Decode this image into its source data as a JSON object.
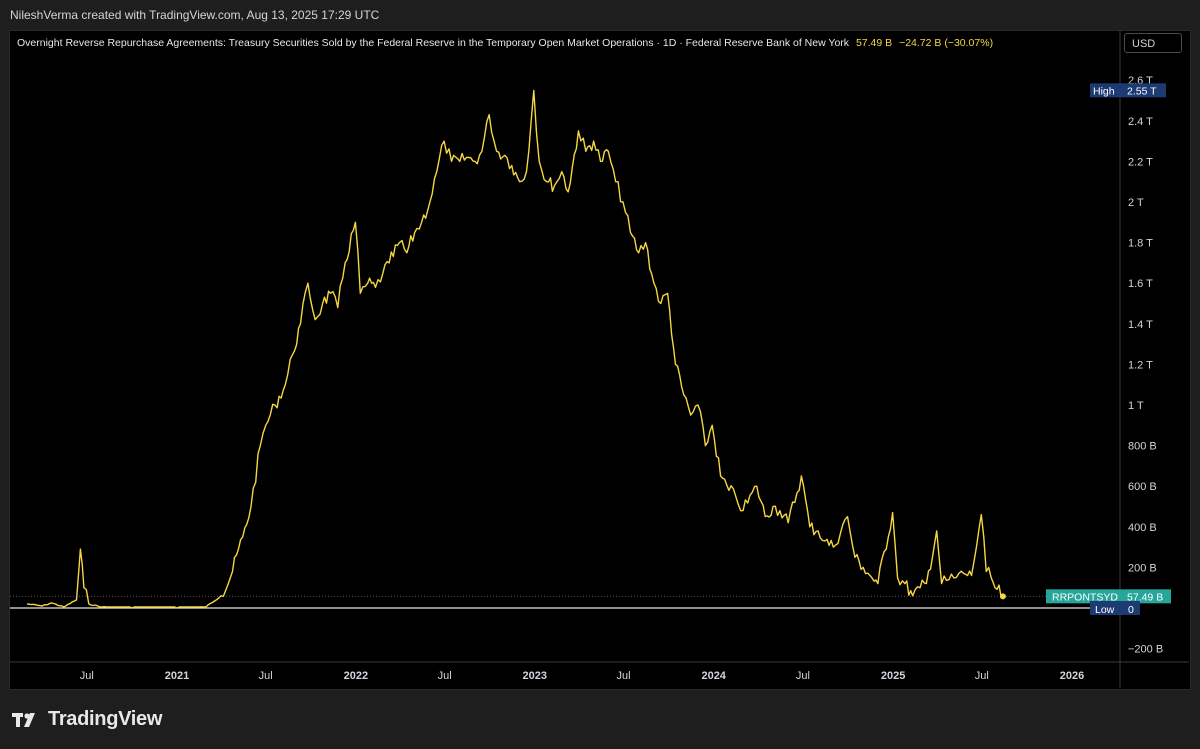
{
  "header": {
    "credit": "NileshVerma created with TradingView.com, Aug 13, 2025 17:29 UTC"
  },
  "legend": {
    "title": "Overnight Reverse Repurchase Agreements: Treasury Securities Sold by the Federal Reserve in the Temporary Open Market Operations · 1D · Federal Reserve Bank of New York",
    "last": "57.49 B",
    "change": "−24.72 B (−30.07%)"
  },
  "currency": "USD",
  "footer": {
    "brand": "TradingView"
  },
  "colors": {
    "series": "#f5d742",
    "background": "#000000",
    "low_line": "#e8e8e8",
    "symbol_label": "#26a69a",
    "high_low_label": "#1e3a72"
  },
  "chart_data": {
    "type": "line",
    "symbol": "RRPONTSYD",
    "y_unit": "USD",
    "ylim": [
      -200000000000,
      2600000000000
    ],
    "y_ticks": [
      {
        "v": 2600000000000,
        "label": "2.6 T"
      },
      {
        "v": 2400000000000,
        "label": "2.4 T"
      },
      {
        "v": 2200000000000,
        "label": "2.2 T"
      },
      {
        "v": 2000000000000,
        "label": "2 T"
      },
      {
        "v": 1800000000000,
        "label": "1.8 T"
      },
      {
        "v": 1600000000000,
        "label": "1.6 T"
      },
      {
        "v": 1400000000000,
        "label": "1.4 T"
      },
      {
        "v": 1200000000000,
        "label": "1.2 T"
      },
      {
        "v": 1000000000000,
        "label": "1 T"
      },
      {
        "v": 800000000000,
        "label": "800 B"
      },
      {
        "v": 600000000000,
        "label": "600 B"
      },
      {
        "v": 400000000000,
        "label": "400 B"
      },
      {
        "v": 200000000000,
        "label": "200 B"
      },
      {
        "v": -200000000000,
        "label": "−200 B"
      }
    ],
    "x_ticks": [
      {
        "date": "2020-07-01",
        "label": "Jul",
        "bold": false
      },
      {
        "date": "2021-01-01",
        "label": "2021",
        "bold": true
      },
      {
        "date": "2021-07-01",
        "label": "Jul",
        "bold": false
      },
      {
        "date": "2022-01-01",
        "label": "2022",
        "bold": true
      },
      {
        "date": "2022-07-01",
        "label": "Jul",
        "bold": false
      },
      {
        "date": "2023-01-01",
        "label": "2023",
        "bold": true
      },
      {
        "date": "2023-07-01",
        "label": "Jul",
        "bold": false
      },
      {
        "date": "2024-01-01",
        "label": "2024",
        "bold": true
      },
      {
        "date": "2024-07-01",
        "label": "Jul",
        "bold": false
      },
      {
        "date": "2025-01-01",
        "label": "2025",
        "bold": true
      },
      {
        "date": "2025-07-01",
        "label": "Jul",
        "bold": false
      },
      {
        "date": "2026-01-01",
        "label": "2026",
        "bold": true
      }
    ],
    "markers": {
      "high": {
        "label": "High",
        "value_label": "2.55 T",
        "value": 2550000000000
      },
      "last": {
        "label": "RRPONTSYD",
        "value_label": "57.49 B",
        "value": 57490000000
      },
      "low": {
        "label": "Low",
        "value_label": "0",
        "value": 0
      }
    },
    "series": [
      {
        "points": [
          [
            "2020-03-01",
            20000000000
          ],
          [
            "2020-04-01",
            10000000000
          ],
          [
            "2020-04-20",
            25000000000
          ],
          [
            "2020-05-15",
            5000000000
          ],
          [
            "2020-06-10",
            40000000000
          ],
          [
            "2020-06-18",
            290000000000
          ],
          [
            "2020-06-25",
            100000000000
          ],
          [
            "2020-07-05",
            20000000000
          ],
          [
            "2020-08-01",
            5000000000
          ],
          [
            "2020-10-01",
            1000000000
          ],
          [
            "2021-01-01",
            0
          ],
          [
            "2021-03-01",
            5000000000
          ],
          [
            "2021-04-01",
            60000000000
          ],
          [
            "2021-04-20",
            150000000000
          ],
          [
            "2021-05-15",
            350000000000
          ],
          [
            "2021-06-01",
            500000000000
          ],
          [
            "2021-06-20",
            800000000000
          ],
          [
            "2021-07-01",
            900000000000
          ],
          [
            "2021-07-20",
            1000000000000
          ],
          [
            "2021-08-10",
            1100000000000
          ],
          [
            "2021-08-25",
            1250000000000
          ],
          [
            "2021-09-10",
            1400000000000
          ],
          [
            "2021-09-25",
            1600000000000
          ],
          [
            "2021-10-10",
            1420000000000
          ],
          [
            "2021-10-25",
            1500000000000
          ],
          [
            "2021-11-10",
            1550000000000
          ],
          [
            "2021-11-25",
            1480000000000
          ],
          [
            "2021-12-10",
            1700000000000
          ],
          [
            "2021-12-31",
            1900000000000
          ],
          [
            "2022-01-10",
            1550000000000
          ],
          [
            "2022-01-25",
            1600000000000
          ],
          [
            "2022-02-10",
            1580000000000
          ],
          [
            "2022-02-25",
            1650000000000
          ],
          [
            "2022-03-10",
            1700000000000
          ],
          [
            "2022-03-31",
            1800000000000
          ],
          [
            "2022-04-15",
            1750000000000
          ],
          [
            "2022-05-01",
            1850000000000
          ],
          [
            "2022-05-15",
            1900000000000
          ],
          [
            "2022-06-01",
            2000000000000
          ],
          [
            "2022-06-15",
            2150000000000
          ],
          [
            "2022-06-30",
            2300000000000
          ],
          [
            "2022-07-15",
            2200000000000
          ],
          [
            "2022-08-01",
            2200000000000
          ],
          [
            "2022-08-15",
            2220000000000
          ],
          [
            "2022-09-01",
            2200000000000
          ],
          [
            "2022-09-15",
            2250000000000
          ],
          [
            "2022-09-30",
            2430000000000
          ],
          [
            "2022-10-15",
            2250000000000
          ],
          [
            "2022-11-01",
            2230000000000
          ],
          [
            "2022-11-15",
            2180000000000
          ],
          [
            "2022-12-01",
            2100000000000
          ],
          [
            "2022-12-15",
            2150000000000
          ],
          [
            "2022-12-30",
            2550000000000
          ],
          [
            "2023-01-10",
            2200000000000
          ],
          [
            "2023-01-25",
            2100000000000
          ],
          [
            "2023-02-10",
            2080000000000
          ],
          [
            "2023-02-25",
            2150000000000
          ],
          [
            "2023-03-10",
            2050000000000
          ],
          [
            "2023-03-31",
            2350000000000
          ],
          [
            "2023-04-15",
            2250000000000
          ],
          [
            "2023-05-01",
            2300000000000
          ],
          [
            "2023-05-15",
            2200000000000
          ],
          [
            "2023-05-31",
            2250000000000
          ],
          [
            "2023-06-15",
            2100000000000
          ],
          [
            "2023-06-30",
            2000000000000
          ],
          [
            "2023-07-15",
            1850000000000
          ],
          [
            "2023-08-01",
            1750000000000
          ],
          [
            "2023-08-15",
            1800000000000
          ],
          [
            "2023-09-01",
            1600000000000
          ],
          [
            "2023-09-15",
            1500000000000
          ],
          [
            "2023-09-29",
            1550000000000
          ],
          [
            "2023-10-15",
            1200000000000
          ],
          [
            "2023-11-01",
            1050000000000
          ],
          [
            "2023-11-15",
            950000000000
          ],
          [
            "2023-11-30",
            1000000000000
          ],
          [
            "2023-12-15",
            800000000000
          ],
          [
            "2023-12-29",
            900000000000
          ],
          [
            "2024-01-15",
            650000000000
          ],
          [
            "2024-02-01",
            580000000000
          ],
          [
            "2024-02-15",
            550000000000
          ],
          [
            "2024-03-01",
            480000000000
          ],
          [
            "2024-03-29",
            600000000000
          ],
          [
            "2024-04-15",
            450000000000
          ],
          [
            "2024-05-01",
            500000000000
          ],
          [
            "2024-05-15",
            480000000000
          ],
          [
            "2024-06-01",
            420000000000
          ],
          [
            "2024-06-28",
            650000000000
          ],
          [
            "2024-07-15",
            400000000000
          ],
          [
            "2024-08-01",
            380000000000
          ],
          [
            "2024-08-15",
            330000000000
          ],
          [
            "2024-09-01",
            300000000000
          ],
          [
            "2024-09-30",
            450000000000
          ],
          [
            "2024-10-15",
            250000000000
          ],
          [
            "2024-11-01",
            200000000000
          ],
          [
            "2024-11-15",
            160000000000
          ],
          [
            "2024-12-01",
            120000000000
          ],
          [
            "2024-12-31",
            470000000000
          ],
          [
            "2025-01-10",
            150000000000
          ],
          [
            "2025-01-25",
            120000000000
          ],
          [
            "2025-02-10",
            60000000000
          ],
          [
            "2025-02-25",
            100000000000
          ],
          [
            "2025-03-10",
            120000000000
          ],
          [
            "2025-03-31",
            380000000000
          ],
          [
            "2025-04-10",
            120000000000
          ],
          [
            "2025-04-25",
            140000000000
          ],
          [
            "2025-05-10",
            150000000000
          ],
          [
            "2025-05-25",
            170000000000
          ],
          [
            "2025-06-10",
            160000000000
          ],
          [
            "2025-06-30",
            460000000000
          ],
          [
            "2025-07-10",
            180000000000
          ],
          [
            "2025-07-20",
            150000000000
          ],
          [
            "2025-07-28",
            100000000000
          ],
          [
            "2025-08-13",
            57490000000
          ]
        ]
      }
    ]
  }
}
